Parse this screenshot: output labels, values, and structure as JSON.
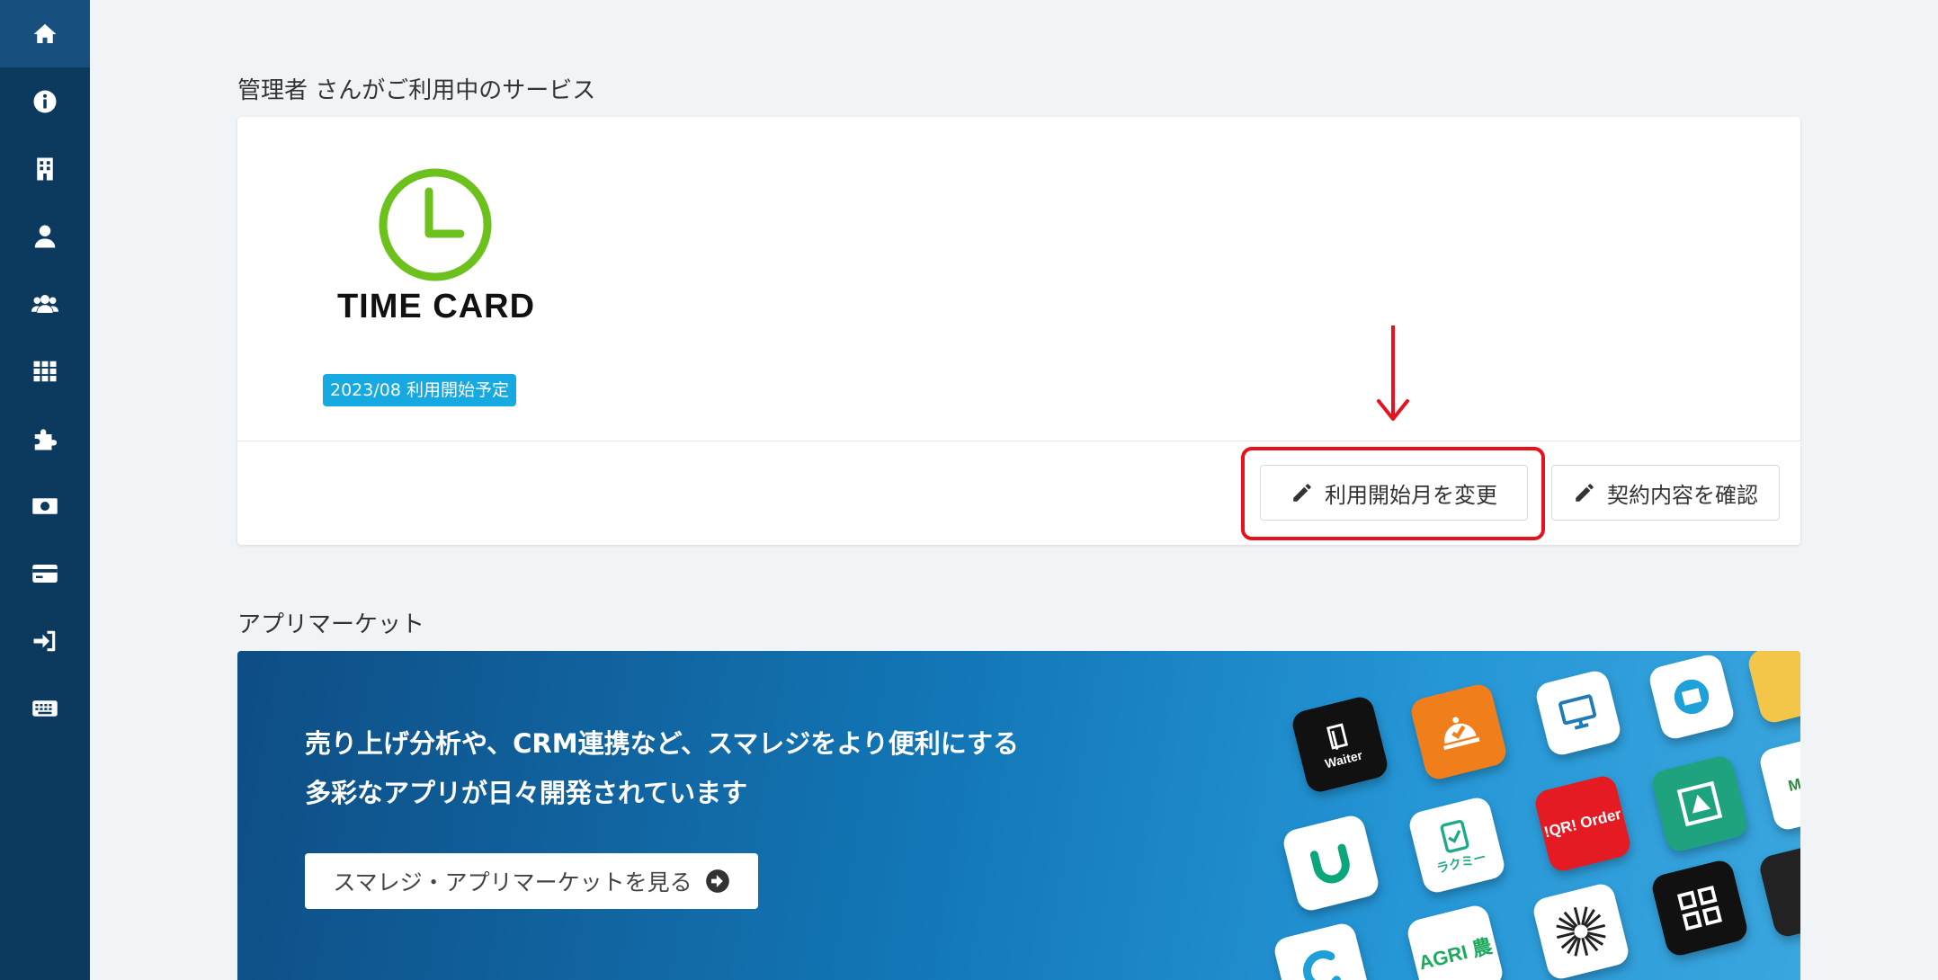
{
  "sidebar": {
    "items": [
      {
        "icon": "home-icon",
        "active": true
      },
      {
        "icon": "info-icon",
        "active": false
      },
      {
        "icon": "building-icon",
        "active": false
      },
      {
        "icon": "user-icon",
        "active": false
      },
      {
        "icon": "users-icon",
        "active": false
      },
      {
        "icon": "grid-icon",
        "active": false
      },
      {
        "icon": "puzzle-icon",
        "active": false
      },
      {
        "icon": "money-icon",
        "active": false
      },
      {
        "icon": "credit-card-icon",
        "active": false
      },
      {
        "icon": "sign-in-icon",
        "active": false
      },
      {
        "icon": "keyboard-icon",
        "active": false
      }
    ]
  },
  "services": {
    "heading": "管理者 さんがご利用中のサービス",
    "service": {
      "logo_text": "TIME CARD",
      "logo_color": "#6cc11d",
      "badge": "2023/08 利用開始予定"
    },
    "buttons": {
      "change_start": "利用開始月を変更",
      "confirm_contract": "契約内容を確認"
    },
    "highlight_color": "#e8121e"
  },
  "market": {
    "heading": "アプリマーケット",
    "line1": "売り上げ分析や、CRM連携など、スマレジをより便利にする",
    "line2": "多彩なアプリが日々開発されています",
    "button": "スマレジ・アプリマーケットを見る",
    "tiles": {
      "waiter": "Waiter",
      "rakumi": "ラクミー",
      "qr_order": "!QR! Order",
      "mr": "Mr. M",
      "agri": "AGRI 農"
    }
  }
}
